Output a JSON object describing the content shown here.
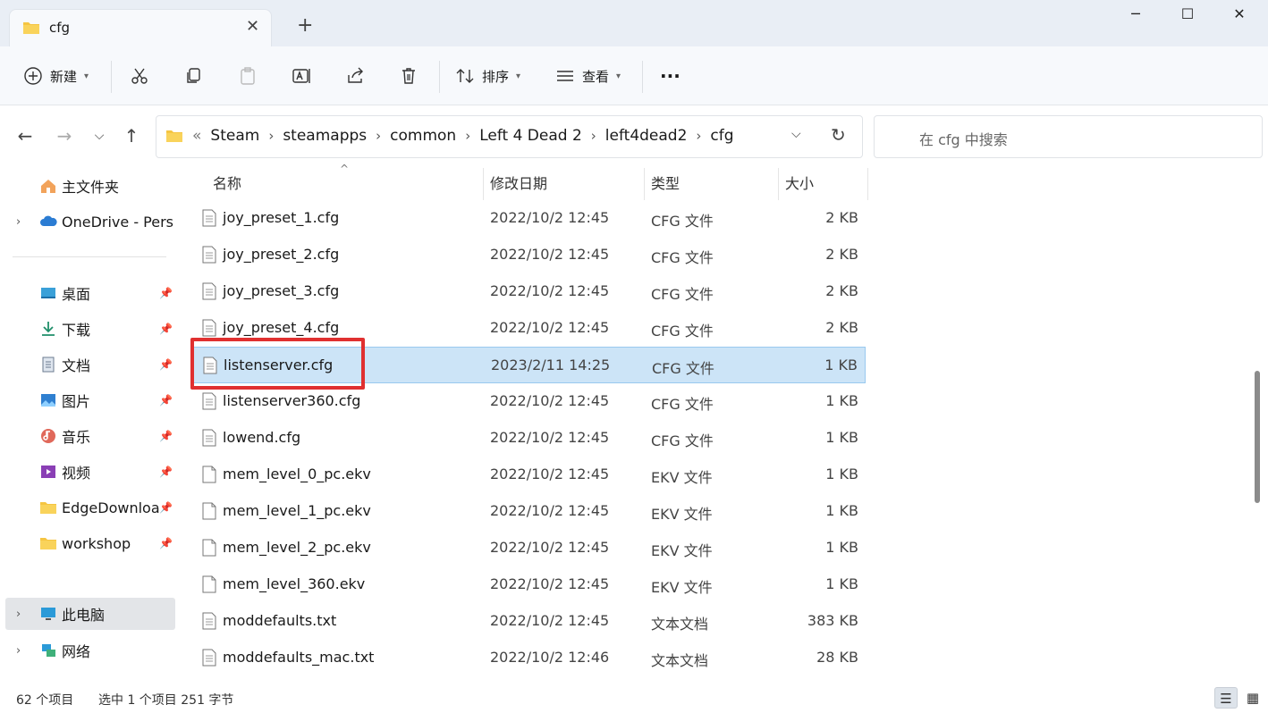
{
  "window": {
    "tab_title": "cfg",
    "new_tab": "+",
    "minimize": "─",
    "maximize": "☐",
    "close": "✕",
    "tab_close": "✕"
  },
  "toolbar": {
    "new_label": "新建",
    "sort_label": "排序",
    "view_label": "查看",
    "more_label": "···"
  },
  "address": {
    "prefix": "«",
    "crumbs": [
      "Steam",
      "steamapps",
      "common",
      "Left 4 Dead 2",
      "left4dead2",
      "cfg"
    ],
    "search_placeholder": "在 cfg 中搜索"
  },
  "sidebar": {
    "home": "主文件夹",
    "onedrive": "OneDrive - Pers",
    "quick": [
      "桌面",
      "下载",
      "文档",
      "图片",
      "音乐",
      "视频",
      "EdgeDownloa",
      "workshop"
    ],
    "this_pc": "此电脑",
    "network": "网络"
  },
  "columns": {
    "name": "名称",
    "date": "修改日期",
    "type": "类型",
    "size": "大小"
  },
  "files": [
    {
      "name": "joy_preset_1.cfg",
      "date": "2022/10/2 12:45",
      "type": "CFG 文件",
      "size": "2 KB"
    },
    {
      "name": "joy_preset_2.cfg",
      "date": "2022/10/2 12:45",
      "type": "CFG 文件",
      "size": "2 KB"
    },
    {
      "name": "joy_preset_3.cfg",
      "date": "2022/10/2 12:45",
      "type": "CFG 文件",
      "size": "2 KB"
    },
    {
      "name": "joy_preset_4.cfg",
      "date": "2022/10/2 12:45",
      "type": "CFG 文件",
      "size": "2 KB"
    },
    {
      "name": "listenserver.cfg",
      "date": "2023/2/11 14:25",
      "type": "CFG 文件",
      "size": "1 KB"
    },
    {
      "name": "listenserver360.cfg",
      "date": "2022/10/2 12:45",
      "type": "CFG 文件",
      "size": "1 KB"
    },
    {
      "name": "lowend.cfg",
      "date": "2022/10/2 12:45",
      "type": "CFG 文件",
      "size": "1 KB"
    },
    {
      "name": "mem_level_0_pc.ekv",
      "date": "2022/10/2 12:45",
      "type": "EKV 文件",
      "size": "1 KB"
    },
    {
      "name": "mem_level_1_pc.ekv",
      "date": "2022/10/2 12:45",
      "type": "EKV 文件",
      "size": "1 KB"
    },
    {
      "name": "mem_level_2_pc.ekv",
      "date": "2022/10/2 12:45",
      "type": "EKV 文件",
      "size": "1 KB"
    },
    {
      "name": "mem_level_360.ekv",
      "date": "2022/10/2 12:45",
      "type": "EKV 文件",
      "size": "1 KB"
    },
    {
      "name": "moddefaults.txt",
      "date": "2022/10/2 12:45",
      "type": "文本文档",
      "size": "383 KB"
    },
    {
      "name": "moddefaults_mac.txt",
      "date": "2022/10/2 12:46",
      "type": "文本文档",
      "size": "28 KB"
    }
  ],
  "status": {
    "count": "62 个项目",
    "selection": "选中 1 个项目  251 字节"
  },
  "colors": {
    "selection": "#cce4f7",
    "highlight_box": "#e03030",
    "folder": "#f5c542"
  }
}
